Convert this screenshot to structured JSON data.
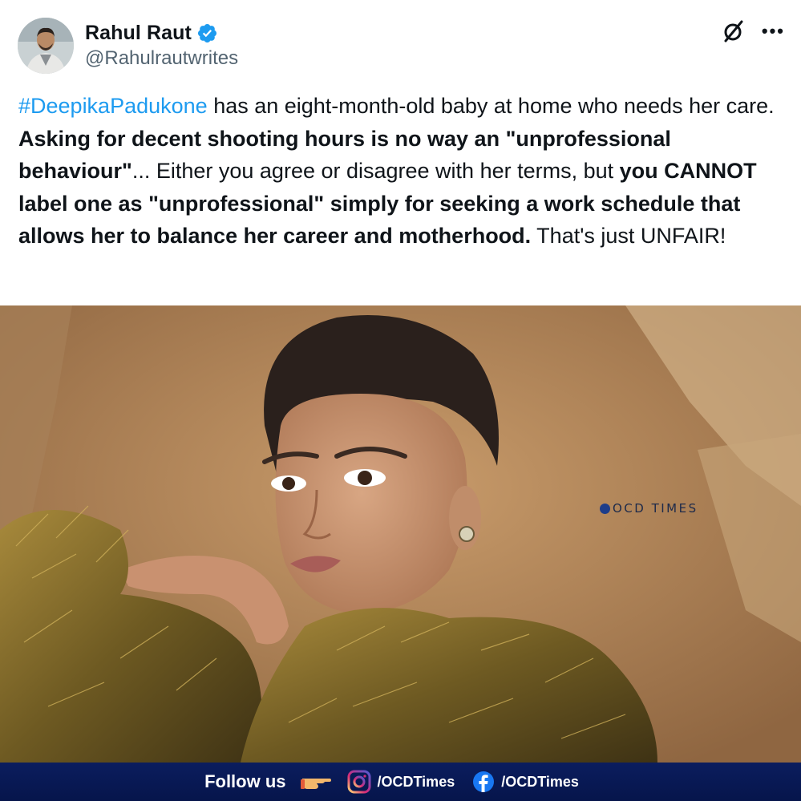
{
  "author": {
    "name": "Rahul Raut",
    "handle": "@Rahulrautwrites",
    "verified": true
  },
  "tweet": {
    "hashtag": "#DeepikaPadukone",
    "seg1": " has an eight-month-old baby at home who needs her care. ",
    "bold1": "Asking for decent shooting hours is no way an \"unprofessional behaviour\"",
    "seg2": "... Either you agree or disagree with her terms, but ",
    "bold2": "you CANNOT label one as \"unprofessional\" simply for seeking a work schedule that allows her to balance her career and motherhood.",
    "seg3": "  That's just UNFAIR!"
  },
  "photo": {
    "watermark": "OCD TIMES"
  },
  "footer": {
    "follow_label": "Follow us",
    "instagram_handle": "/OCDTimes",
    "facebook_handle": "/OCDTimes"
  },
  "colors": {
    "hashtag": "#1d9bf0",
    "verified": "#1d9bf0",
    "footer_bg": "#06154b",
    "handle": "#536471"
  },
  "icons": {
    "verified": "verified-badge-icon",
    "grok": "grok-slash-icon",
    "more": "more-dots-icon",
    "pointing": "pointing-hand-icon",
    "instagram": "instagram-icon",
    "facebook": "facebook-icon"
  }
}
